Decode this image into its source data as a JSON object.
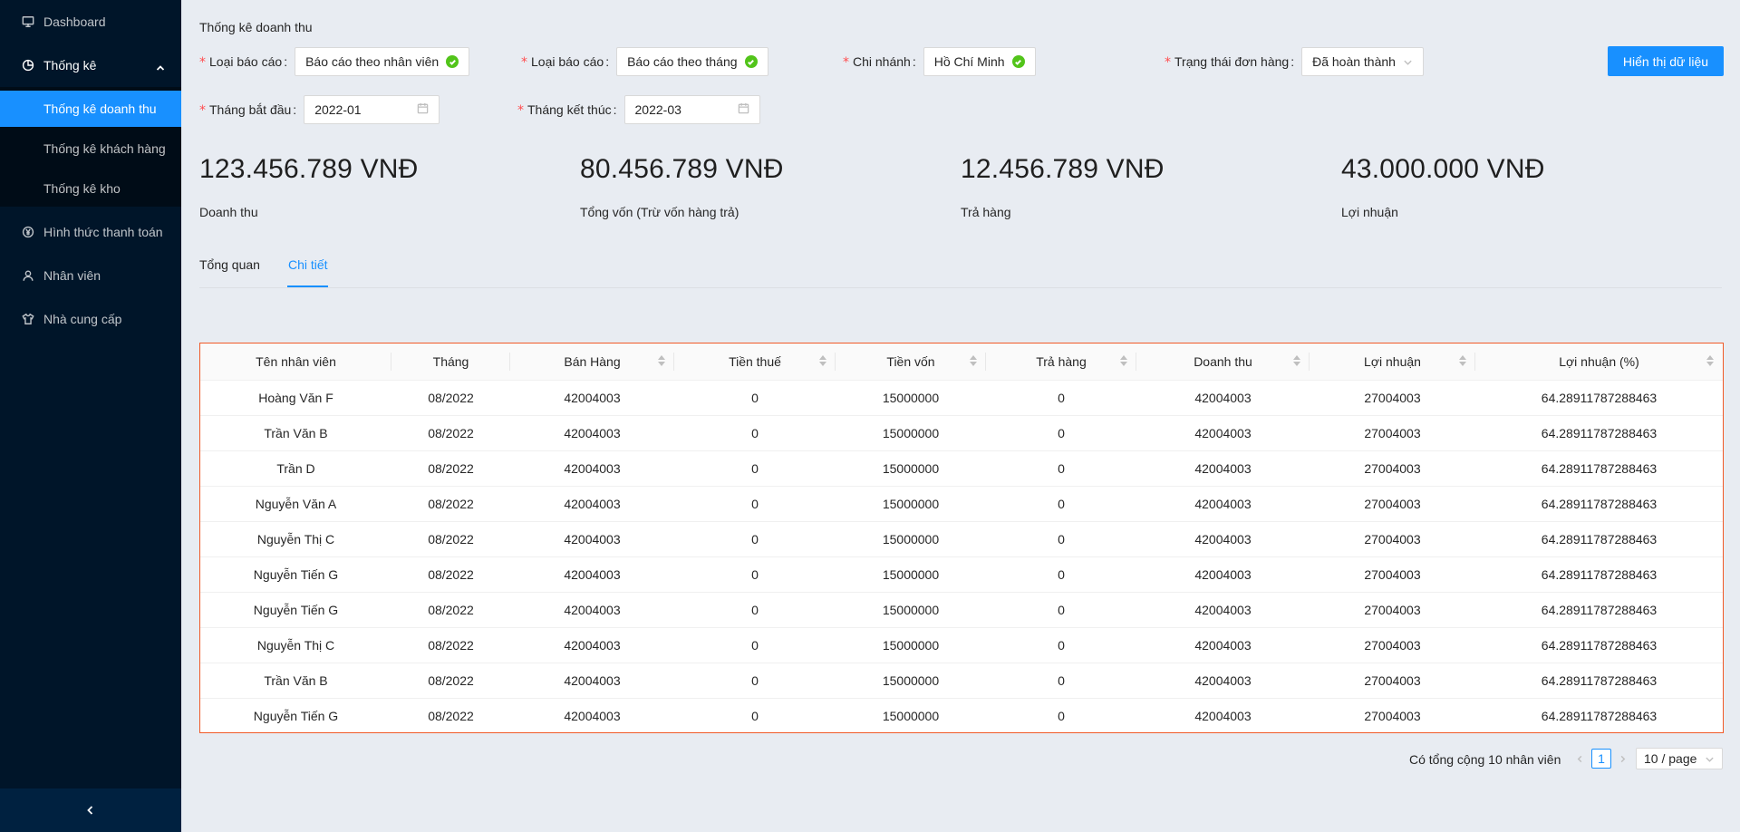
{
  "sidebar": {
    "items": [
      {
        "label": "Dashboard",
        "icon": "desktop-icon"
      },
      {
        "label": "Thống kê",
        "icon": "pie-chart-icon"
      },
      {
        "label": "Hình thức thanh toán",
        "icon": "yen-circle-icon"
      },
      {
        "label": "Nhân viên",
        "icon": "user-icon"
      },
      {
        "label": "Nhà cung cấp",
        "icon": "shirt-icon"
      }
    ],
    "sub_items": [
      {
        "label": "Thống kê doanh thu",
        "active": true
      },
      {
        "label": "Thống kê khách hàng",
        "active": false
      },
      {
        "label": "Thống kê kho",
        "active": false
      }
    ],
    "accent_color": "#1890ff"
  },
  "page": {
    "title": "Thống kê doanh thu"
  },
  "filters": {
    "report_type_1": {
      "label": "Loại báo cáo",
      "value": "Báo cáo theo nhân viên"
    },
    "report_type_2": {
      "label": "Loại báo cáo",
      "value": "Báo cáo theo tháng"
    },
    "branch": {
      "label": "Chi nhánh",
      "value": "Hồ Chí Minh"
    },
    "order_status": {
      "label": "Trạng thái đơn hàng",
      "value": "Đã hoàn thành"
    },
    "start_month": {
      "label": "Tháng bắt đầu",
      "value": "2022-01"
    },
    "end_month": {
      "label": "Tháng kết thúc",
      "value": "2022-03"
    },
    "submit_label": "Hiển thị dữ liệu"
  },
  "stats": [
    {
      "value": "123.456.789 VNĐ",
      "label": "Doanh thu"
    },
    {
      "value": "80.456.789 VNĐ",
      "label": "Tổng vốn (Trừ vốn hàng trả)"
    },
    {
      "value": "12.456.789 VNĐ",
      "label": "Trả hàng"
    },
    {
      "value": "43.000.000 VNĐ",
      "label": "Lợi nhuận"
    }
  ],
  "tabs": [
    {
      "label": "Tổng quan",
      "active": false
    },
    {
      "label": "Chi tiết",
      "active": true
    }
  ],
  "table": {
    "columns": [
      "Tên nhân viên",
      "Tháng",
      "Bán Hàng",
      "Tiền thuế",
      "Tiền vốn",
      "Trả hàng",
      "Doanh thu",
      "Lợi nhuận",
      "Lợi nhuận (%)"
    ],
    "rows": [
      [
        "Hoàng Văn F",
        "08/2022",
        "42004003",
        "0",
        "15000000",
        "0",
        "42004003",
        "27004003",
        "64.28911787288463"
      ],
      [
        "Trần Văn B",
        "08/2022",
        "42004003",
        "0",
        "15000000",
        "0",
        "42004003",
        "27004003",
        "64.28911787288463"
      ],
      [
        "Trần D",
        "08/2022",
        "42004003",
        "0",
        "15000000",
        "0",
        "42004003",
        "27004003",
        "64.28911787288463"
      ],
      [
        "Nguyễn Văn A",
        "08/2022",
        "42004003",
        "0",
        "15000000",
        "0",
        "42004003",
        "27004003",
        "64.28911787288463"
      ],
      [
        "Nguyễn Thị C",
        "08/2022",
        "42004003",
        "0",
        "15000000",
        "0",
        "42004003",
        "27004003",
        "64.28911787288463"
      ],
      [
        "Nguyễn Tiến G",
        "08/2022",
        "42004003",
        "0",
        "15000000",
        "0",
        "42004003",
        "27004003",
        "64.28911787288463"
      ],
      [
        "Nguyễn Tiến G",
        "08/2022",
        "42004003",
        "0",
        "15000000",
        "0",
        "42004003",
        "27004003",
        "64.28911787288463"
      ],
      [
        "Nguyễn Thị C",
        "08/2022",
        "42004003",
        "0",
        "15000000",
        "0",
        "42004003",
        "27004003",
        "64.28911787288463"
      ],
      [
        "Trần Văn B",
        "08/2022",
        "42004003",
        "0",
        "15000000",
        "0",
        "42004003",
        "27004003",
        "64.28911787288463"
      ],
      [
        "Nguyễn Tiến G",
        "08/2022",
        "42004003",
        "0",
        "15000000",
        "0",
        "42004003",
        "27004003",
        "64.28911787288463"
      ]
    ]
  },
  "pagination": {
    "total_text": "Có tổng cộng 10 nhân viên",
    "current_page": "1",
    "page_size": "10 / page"
  }
}
